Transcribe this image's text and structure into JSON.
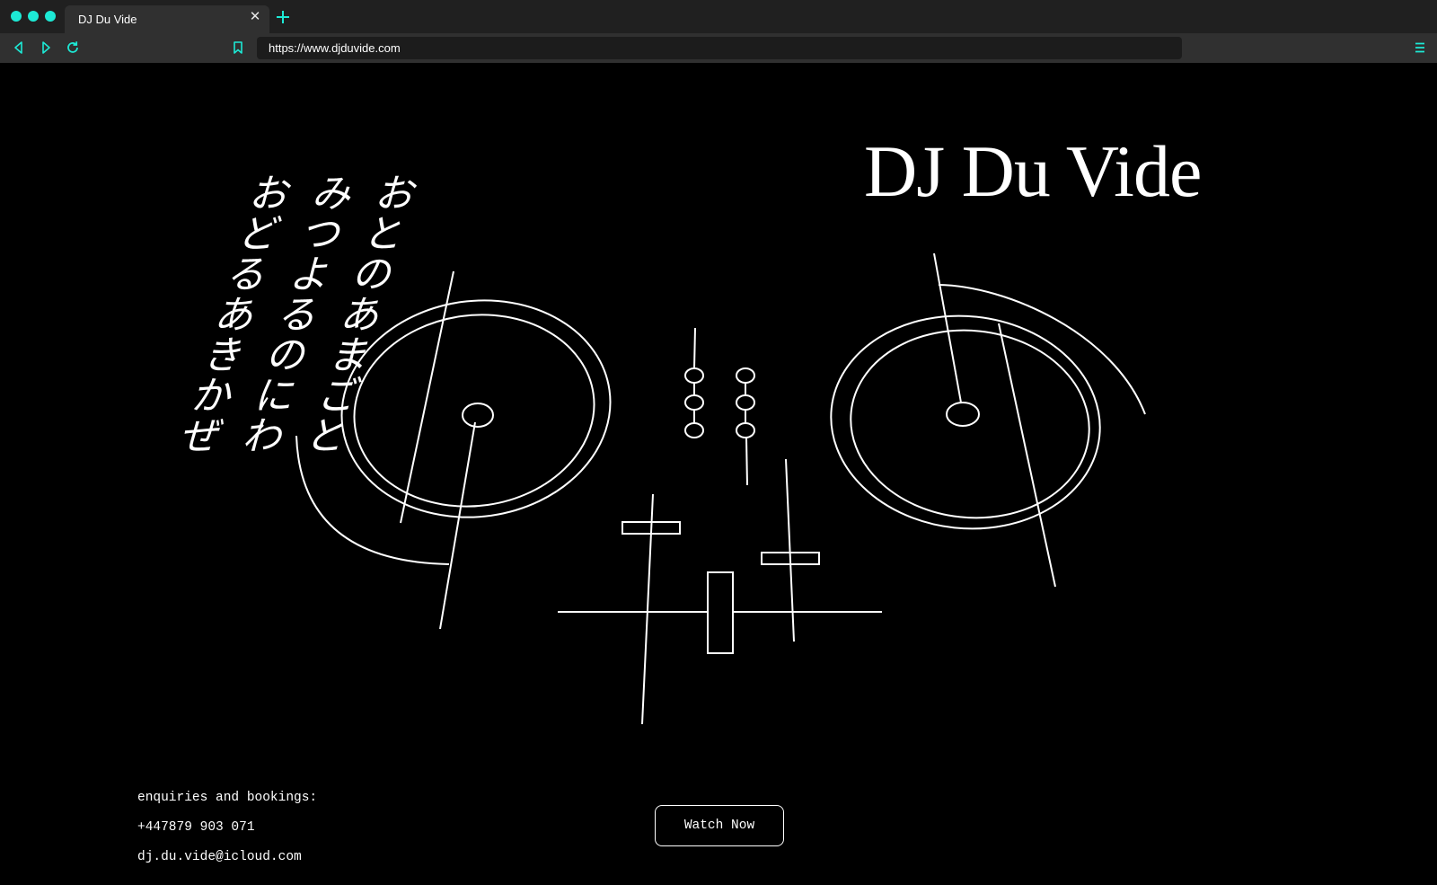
{
  "browser": {
    "tab_title": "DJ Du Vide",
    "url": "https://www.djduvide.com",
    "accent_color": "#1de9d5",
    "icons": {
      "traffic_lights": [
        "dot-icon",
        "dot-icon",
        "dot-icon"
      ],
      "close_tab": "close-icon",
      "new_tab": "plus-icon",
      "back": "back-arrow-icon",
      "forward": "forward-arrow-icon",
      "reload": "reload-icon",
      "bookmark": "bookmark-icon",
      "menu": "menu-icon"
    }
  },
  "site": {
    "title": "DJ Du Vide",
    "poem_columns": [
      "おとのあまごと",
      "みつよるのにわ",
      "おどるあきかぜ"
    ],
    "contact": {
      "heading": "enquiries and bookings:",
      "phone": "+447879 903 071",
      "email": "dj.du.vide@icloud.com"
    },
    "watch_button_label": "Watch Now",
    "colors": {
      "background": "#000000",
      "foreground": "#ffffff"
    }
  }
}
